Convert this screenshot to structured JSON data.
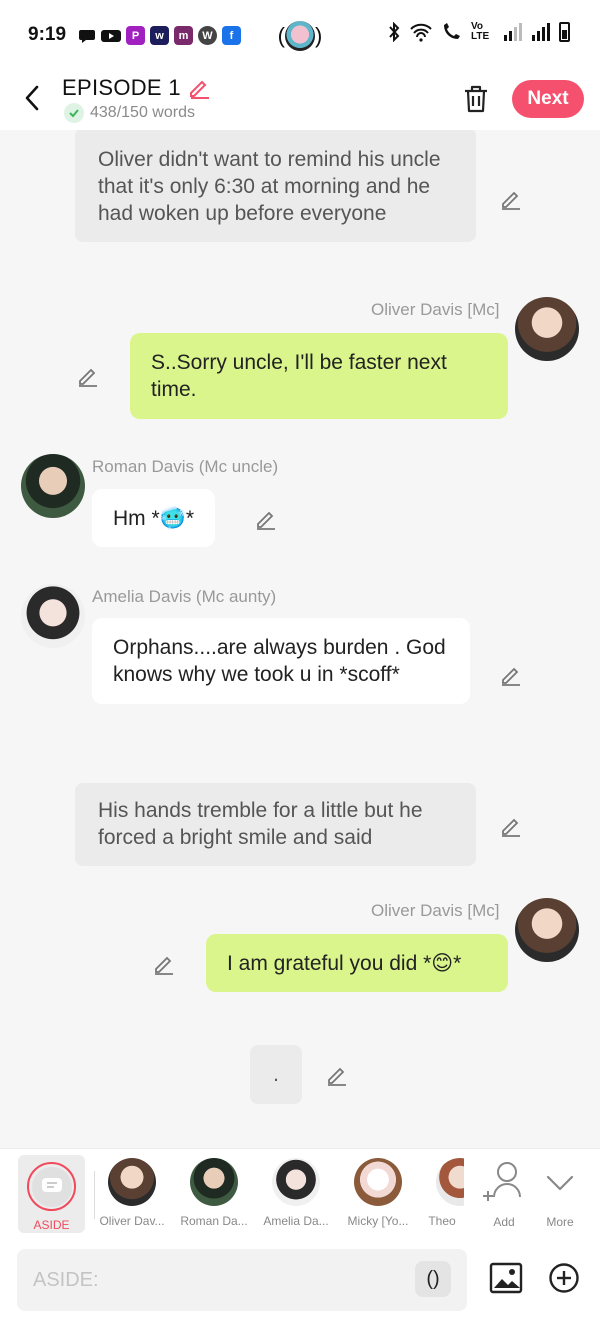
{
  "status_bar": {
    "time": "9:19",
    "apps": [
      "P",
      "w",
      "m",
      "W",
      "f"
    ],
    "net": "Vo LTE"
  },
  "header": {
    "title": "EPISODE 1",
    "word_count": "438/150 words",
    "next_label": "Next",
    "accent_color": "#f5516e"
  },
  "messages": {
    "aside1": "Oliver didn't want to remind his uncle that it's only 6:30 at morning and he had woken up before everyone",
    "oliver_name": "Oliver Davis [Mc]",
    "oliver_msg1": "S..Sorry uncle, I'll be faster next time.",
    "roman_name": "Roman Davis (Mc uncle)",
    "roman_msg": "Hm *🥶*",
    "amelia_name": "Amelia Davis (Mc aunty)",
    "amelia_msg": "Orphans....are always burden . God knows why we took u in *scoff*",
    "aside2": "His hands tremble for a little but he forced a bright smile and said",
    "oliver_msg2": "I am grateful you did *😊*",
    "dot_msg": "."
  },
  "character_bar": {
    "aside_label": "ASIDE",
    "characters": [
      "Oliver Dav...",
      "Roman Da...",
      "Amelia Da...",
      "Micky [Yo...",
      "Theo"
    ],
    "add_label": "Add",
    "more_label": "More"
  },
  "input": {
    "placeholder": "ASIDE:",
    "paren_label": "()"
  }
}
